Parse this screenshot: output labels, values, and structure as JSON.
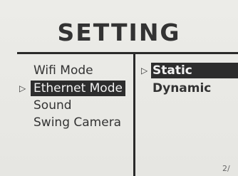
{
  "header": {
    "title": "SETTING"
  },
  "menu": {
    "items": [
      {
        "label": "Wifi Mode",
        "selected": false
      },
      {
        "label": "Ethernet Mode",
        "selected": true
      },
      {
        "label": "Sound",
        "selected": false
      },
      {
        "label": "Swing Camera",
        "selected": false
      }
    ]
  },
  "submenu": {
    "items": [
      {
        "label": "Static",
        "selected": true
      },
      {
        "label": "Dynamic",
        "selected": false
      }
    ]
  },
  "cursor_glyph": "▷",
  "page_indicator": "2/"
}
